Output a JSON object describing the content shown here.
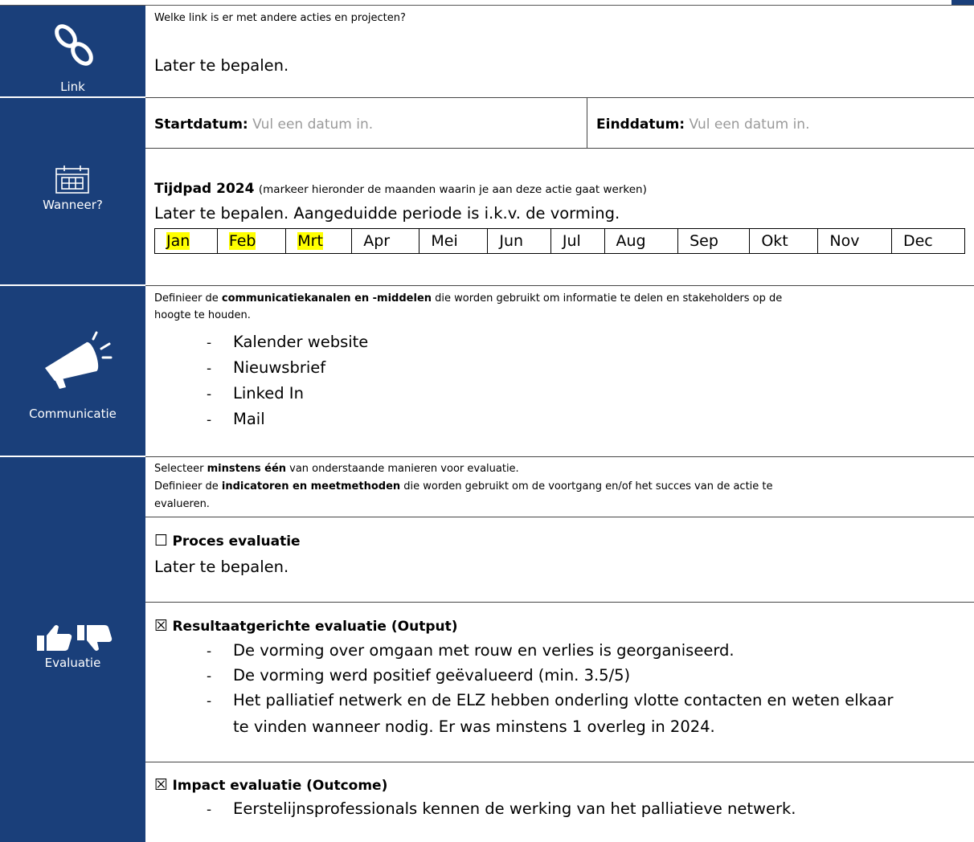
{
  "link": {
    "label": "Link",
    "icon": "link-icon",
    "question": "Welke link is er met andere acties en projecten?",
    "answer": "Later te bepalen."
  },
  "wanneer": {
    "label": "Wanneer?",
    "icon": "calendar-icon",
    "start_label": "Startdatum:",
    "start_placeholder": "Vul een datum in.",
    "end_label": "Einddatum:",
    "end_placeholder": "Vul een datum in.",
    "timeline_title": "Tijdpad 2024",
    "timeline_hint": "(markeer hieronder de maanden waarin je aan deze actie gaat werken)",
    "timeline_note": "Later te bepalen. Aangeduidde periode is i.k.v. de vorming.",
    "months": [
      {
        "name": "Jan",
        "highlighted": true
      },
      {
        "name": "Feb",
        "highlighted": true
      },
      {
        "name": "Mrt",
        "highlighted": true
      },
      {
        "name": "Apr",
        "highlighted": false
      },
      {
        "name": "Mei",
        "highlighted": false
      },
      {
        "name": "Jun",
        "highlighted": false
      },
      {
        "name": "Jul",
        "highlighted": false
      },
      {
        "name": "Aug",
        "highlighted": false
      },
      {
        "name": "Sep",
        "highlighted": false
      },
      {
        "name": "Okt",
        "highlighted": false
      },
      {
        "name": "Nov",
        "highlighted": false
      },
      {
        "name": "Dec",
        "highlighted": false
      }
    ]
  },
  "communicatie": {
    "label": "Communicatie",
    "icon": "megaphone-icon",
    "intro_pre": "Definieer de ",
    "intro_bold": "communicatiekanalen en -middelen",
    "intro_post": " die worden gebruikt om informatie te delen en stakeholders op de",
    "intro_line2": "hoogte te houden.",
    "items": [
      "Kalender website",
      "Nieuwsbrief",
      "Linked In",
      "Mail"
    ]
  },
  "evaluatie": {
    "label": "Evaluatie",
    "icon": "thumbs-up-down-icon",
    "intro1_pre": "Selecteer ",
    "intro1_bold": "minstens één",
    "intro1_post": " van onderstaande manieren voor evaluatie.",
    "intro2_pre": "Definieer de ",
    "intro2_bold": "indicatoren en meetmethoden",
    "intro2_post": " die worden gebruikt om de voortgang en/of het succes van de actie te",
    "intro2_line2": "evalueren.",
    "proces": {
      "checkbox": "☐",
      "title": "Proces evaluatie",
      "text": "Later te bepalen."
    },
    "resultaat": {
      "checkbox": "☒",
      "title": "Resultaatgerichte evaluatie (Output)",
      "items": [
        "De vorming over omgaan met rouw en verlies is georganiseerd.",
        "De vorming werd positief geëvalueerd (min. 3.5/5)",
        "Het palliatief netwerk en de ELZ hebben onderling vlotte contacten en weten elkaar",
        "te vinden wanneer nodig. Er was minstens 1 overleg in 2024."
      ]
    },
    "impact": {
      "checkbox": "☒",
      "title": "Impact evaluatie (Outcome)",
      "items": [
        "Eerstelijnsprofessionals kennen de werking van het palliatieve netwerk."
      ]
    },
    "dash": "-"
  },
  "colors": {
    "sidebar": "#1a3f7a",
    "highlight": "#ffff00",
    "placeholder": "#9a9a9a"
  }
}
